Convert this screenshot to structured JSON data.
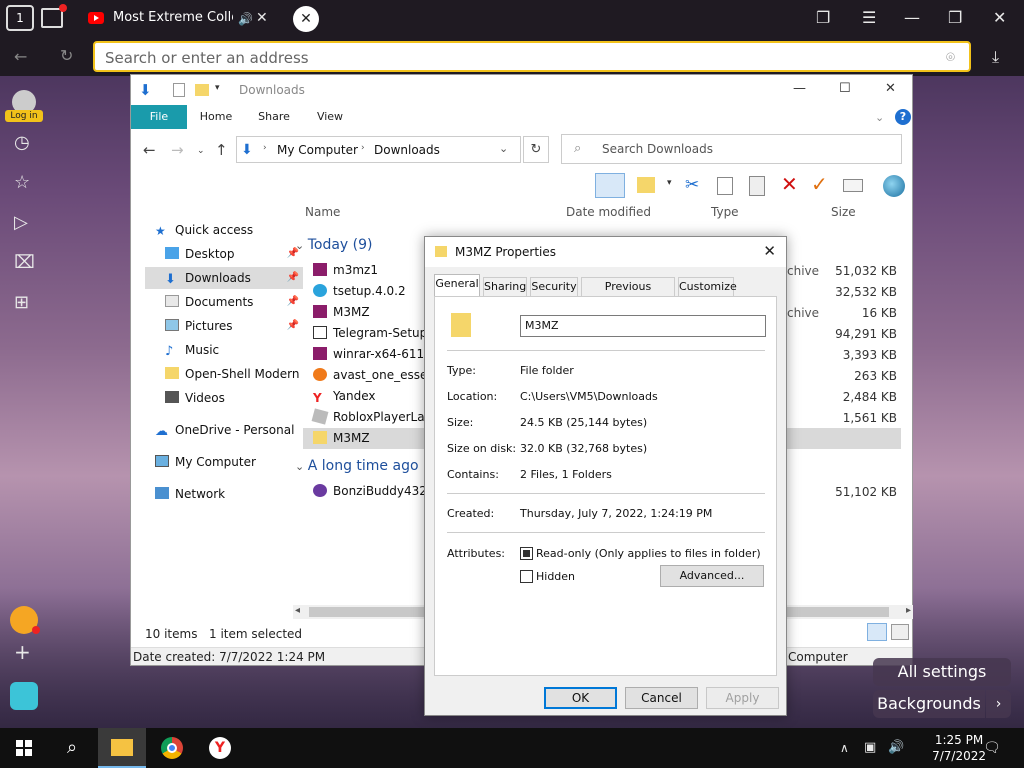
{
  "browser": {
    "tab_count": "1",
    "tab_title": "Most Extreme Collect",
    "address_placeholder": "Search or enter an address",
    "login_label": "Log in"
  },
  "explorer": {
    "title": "Downloads",
    "ribbon_tabs": [
      "File",
      "Home",
      "Share",
      "View"
    ],
    "breadcrumb": [
      "My Computer",
      "Downloads"
    ],
    "search_placeholder": "Search Downloads",
    "columns": [
      "Name",
      "Date modified",
      "Type",
      "Size"
    ],
    "nav": [
      {
        "label": "Quick access"
      },
      {
        "label": "Desktop"
      },
      {
        "label": "Downloads"
      },
      {
        "label": "Documents"
      },
      {
        "label": "Pictures"
      },
      {
        "label": "Music"
      },
      {
        "label": "Open-Shell Modern"
      },
      {
        "label": "Videos"
      },
      {
        "label": "OneDrive - Personal"
      },
      {
        "label": "My Computer"
      },
      {
        "label": "Network"
      }
    ],
    "group_today": "Today (9)",
    "group_old": "A long time ago (",
    "files_today": [
      {
        "name": "m3mz1",
        "type": "chive",
        "size": "51,032 KB"
      },
      {
        "name": "tsetup.4.0.2",
        "type": "",
        "size": "32,532 KB"
      },
      {
        "name": "M3MZ",
        "type": "chive",
        "size": "16 KB"
      },
      {
        "name": "Telegram-Setup-PC",
        "type": "",
        "size": "94,291 KB"
      },
      {
        "name": "winrar-x64-611",
        "type": "",
        "size": "3,393 KB"
      },
      {
        "name": "avast_one_essentia",
        "type": "",
        "size": "263 KB"
      },
      {
        "name": "Yandex",
        "type": "",
        "size": "2,484 KB"
      },
      {
        "name": "RobloxPlayerLaunc",
        "type": "",
        "size": "1,561 KB"
      },
      {
        "name": "M3MZ",
        "type": "",
        "size": ""
      }
    ],
    "files_old": [
      {
        "name": "BonziBuddy432",
        "size": "51,102 KB"
      }
    ],
    "status_items": "10 items",
    "status_selected": "1 item selected",
    "date_created": "Date created: 7/7/2022 1:24 PM",
    "status_right": "Computer"
  },
  "dialog": {
    "title": "M3MZ Properties",
    "tabs": [
      "General",
      "Sharing",
      "Security",
      "Previous Versions",
      "Customize"
    ],
    "name_value": "M3MZ",
    "rows": [
      {
        "label": "Type:",
        "value": "File folder"
      },
      {
        "label": "Location:",
        "value": "C:\\Users\\VM5\\Downloads"
      },
      {
        "label": "Size:",
        "value": "24.5 KB (25,144 bytes)"
      },
      {
        "label": "Size on disk:",
        "value": "32.0 KB (32,768 bytes)"
      },
      {
        "label": "Contains:",
        "value": "2 Files, 1 Folders"
      }
    ],
    "created_label": "Created:",
    "created_value": "Thursday, July 7, 2022, 1:24:19 PM",
    "attributes_label": "Attributes:",
    "readonly_label": "Read-only (Only applies to files in folder)",
    "hidden_label": "Hidden",
    "advanced_label": "Advanced...",
    "ok_label": "OK",
    "cancel_label": "Cancel",
    "apply_label": "Apply"
  },
  "widgets": {
    "all_settings": "All settings",
    "backgrounds": "Backgrounds"
  },
  "taskbar": {
    "time": "1:25 PM",
    "date": "7/7/2022"
  },
  "colors": {
    "accent_yellow": "#f2c21a",
    "file_tab": "#1a9bab",
    "selection": "#cce8ff",
    "dialog_default_btn": "#0078d7"
  }
}
